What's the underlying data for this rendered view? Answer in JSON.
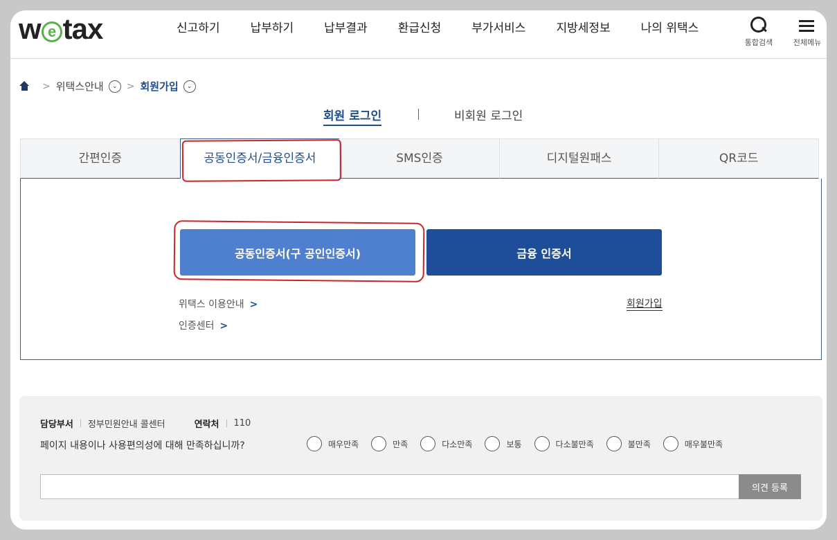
{
  "brand": {
    "logo_w": "w",
    "logo_e": "e",
    "logo_rest": "tax"
  },
  "nav": [
    "신고하기",
    "납부하기",
    "납부결과",
    "환급신청",
    "부가서비스",
    "지방세정보",
    "나의 위택스"
  ],
  "util": {
    "search_label": "통합검색",
    "menu_label": "전체메뉴"
  },
  "breadcrumb": {
    "item1": "위택스안내",
    "item2": "회원가입"
  },
  "login_type": {
    "member": "회원 로그인",
    "guest": "비회원 로그인"
  },
  "tabs": [
    "간편인증",
    "공동인증서/금융인증서",
    "SMS인증",
    "디지털원패스",
    "QR코드"
  ],
  "panel": {
    "joint_cert_button": "공동인증서(구 공인인증서)",
    "financial_cert_button": "금융 인증서",
    "guide_link": "위택스 이용안내",
    "cert_center_link": "인증센터",
    "join_link": "회원가입",
    "chevron": ">"
  },
  "survey": {
    "dept_label": "담당부서",
    "dept_value": "정부민원안내 콜센터",
    "contact_label": "연락처",
    "contact_value": "110",
    "question": "페이지 내용이나 사용편의성에 대해 만족하십니까?",
    "options": [
      "매우만족",
      "만족",
      "다소만족",
      "보통",
      "다소불만족",
      "불만족",
      "매우불만족"
    ],
    "submit_label": "의견 등록"
  },
  "colors": {
    "accent": "#1f4e8c",
    "joint_button": "#4f80d0",
    "financial_button": "#1e4e99",
    "annotation": "#c8262c",
    "logo_green": "#58b04a"
  }
}
